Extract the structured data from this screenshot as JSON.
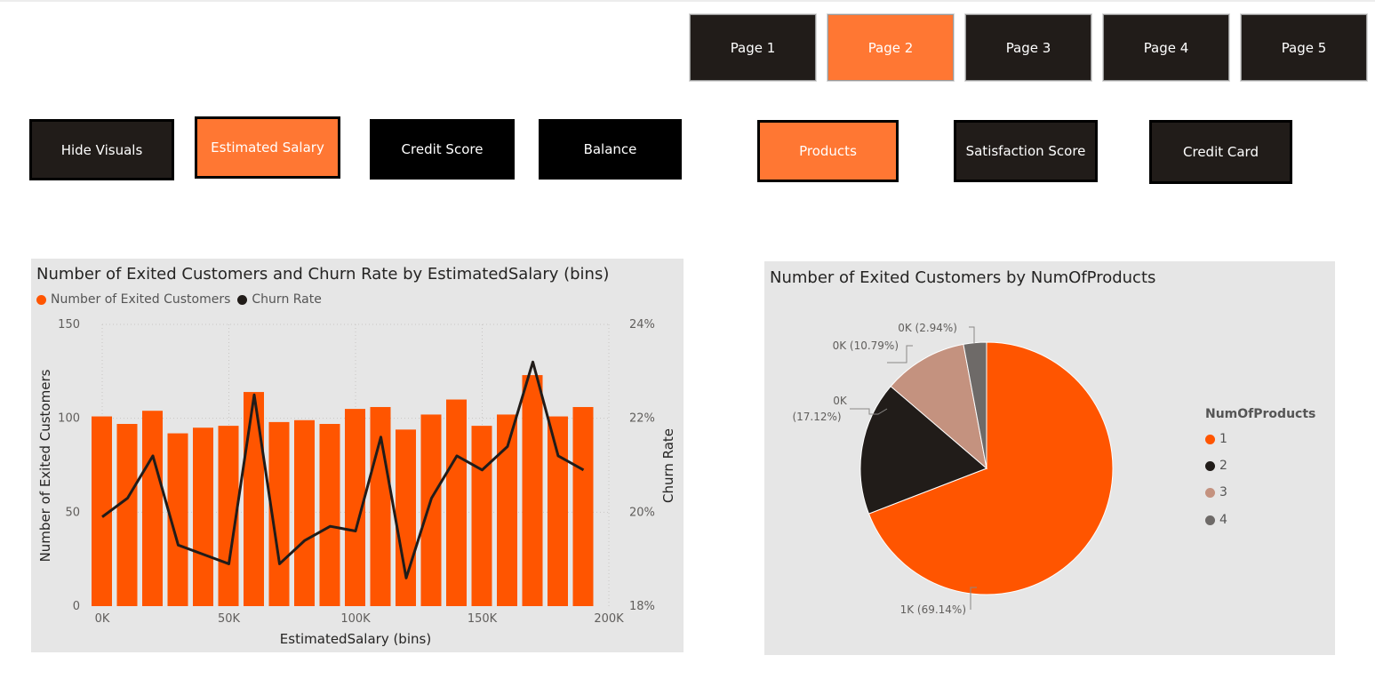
{
  "nav": {
    "pages": [
      {
        "label": "Page 1",
        "active": false
      },
      {
        "label": "Page 2",
        "active": true
      },
      {
        "label": "Page 3",
        "active": false
      },
      {
        "label": "Page 4",
        "active": false
      },
      {
        "label": "Page 5",
        "active": false
      }
    ]
  },
  "filters": {
    "hide_visuals": "Hide Visuals",
    "estimated_salary": "Estimated Salary",
    "credit_score": "Credit Score",
    "balance": "Balance",
    "products": "Products",
    "satisfaction_score": "Satisfaction Score",
    "credit_card": "Credit Card"
  },
  "colors": {
    "accent_orange": "#ff7733",
    "bar_orange": "#ff5500",
    "dark": "#211c19",
    "pie_tan": "#c4927f",
    "pie_gray": "#6e6a68",
    "card_bg": "#e6e6e6"
  },
  "chart_data": [
    {
      "type": "bar+line",
      "title": "Number of Exited Customers and Churn Rate by EstimatedSalary (bins)",
      "legend": {
        "position": "top-left",
        "entries": [
          "Number of Exited Customers",
          "Churn Rate"
        ]
      },
      "xlabel": "EstimatedSalary (bins)",
      "ylabel": "Number of Exited Customers",
      "y2label": "Churn Rate",
      "ylim": [
        0,
        150
      ],
      "y2lim": [
        18,
        24
      ],
      "y_ticks": [
        "0",
        "50",
        "100",
        "150"
      ],
      "y2_ticks": [
        "18%",
        "20%",
        "22%",
        "24%"
      ],
      "x_ticks": [
        "0K",
        "50K",
        "100K",
        "150K",
        "200K"
      ],
      "grid": true,
      "x": [
        0,
        10000,
        20000,
        30000,
        40000,
        50000,
        60000,
        70000,
        80000,
        90000,
        100000,
        110000,
        120000,
        130000,
        140000,
        150000,
        160000,
        170000,
        180000,
        190000
      ],
      "series": [
        {
          "name": "Number of Exited Customers",
          "type": "bar",
          "values": [
            101,
            97,
            104,
            92,
            95,
            96,
            114,
            98,
            99,
            97,
            105,
            106,
            94,
            102,
            110,
            96,
            102,
            123,
            101,
            106
          ]
        },
        {
          "name": "Churn Rate",
          "type": "line",
          "values": [
            19.9,
            20.3,
            21.2,
            19.3,
            19.1,
            18.9,
            22.5,
            18.9,
            19.4,
            19.7,
            19.6,
            21.6,
            18.6,
            20.3,
            21.2,
            20.9,
            21.4,
            23.2,
            21.2,
            20.9
          ]
        }
      ]
    },
    {
      "type": "pie",
      "title": "Number of Exited Customers by NumOfProducts",
      "legend": {
        "position": "right",
        "title": "NumOfProducts",
        "entries": [
          "1",
          "2",
          "3",
          "4"
        ]
      },
      "slices": [
        {
          "category": "1",
          "percent": 69.14,
          "label": "1K (69.14%)"
        },
        {
          "category": "2",
          "percent": 17.12,
          "label_line1": "0K",
          "label_line2": "(17.12%)"
        },
        {
          "category": "3",
          "percent": 10.79,
          "label": "0K (10.79%)"
        },
        {
          "category": "4",
          "percent": 2.94,
          "label": "0K (2.94%)"
        }
      ]
    }
  ]
}
